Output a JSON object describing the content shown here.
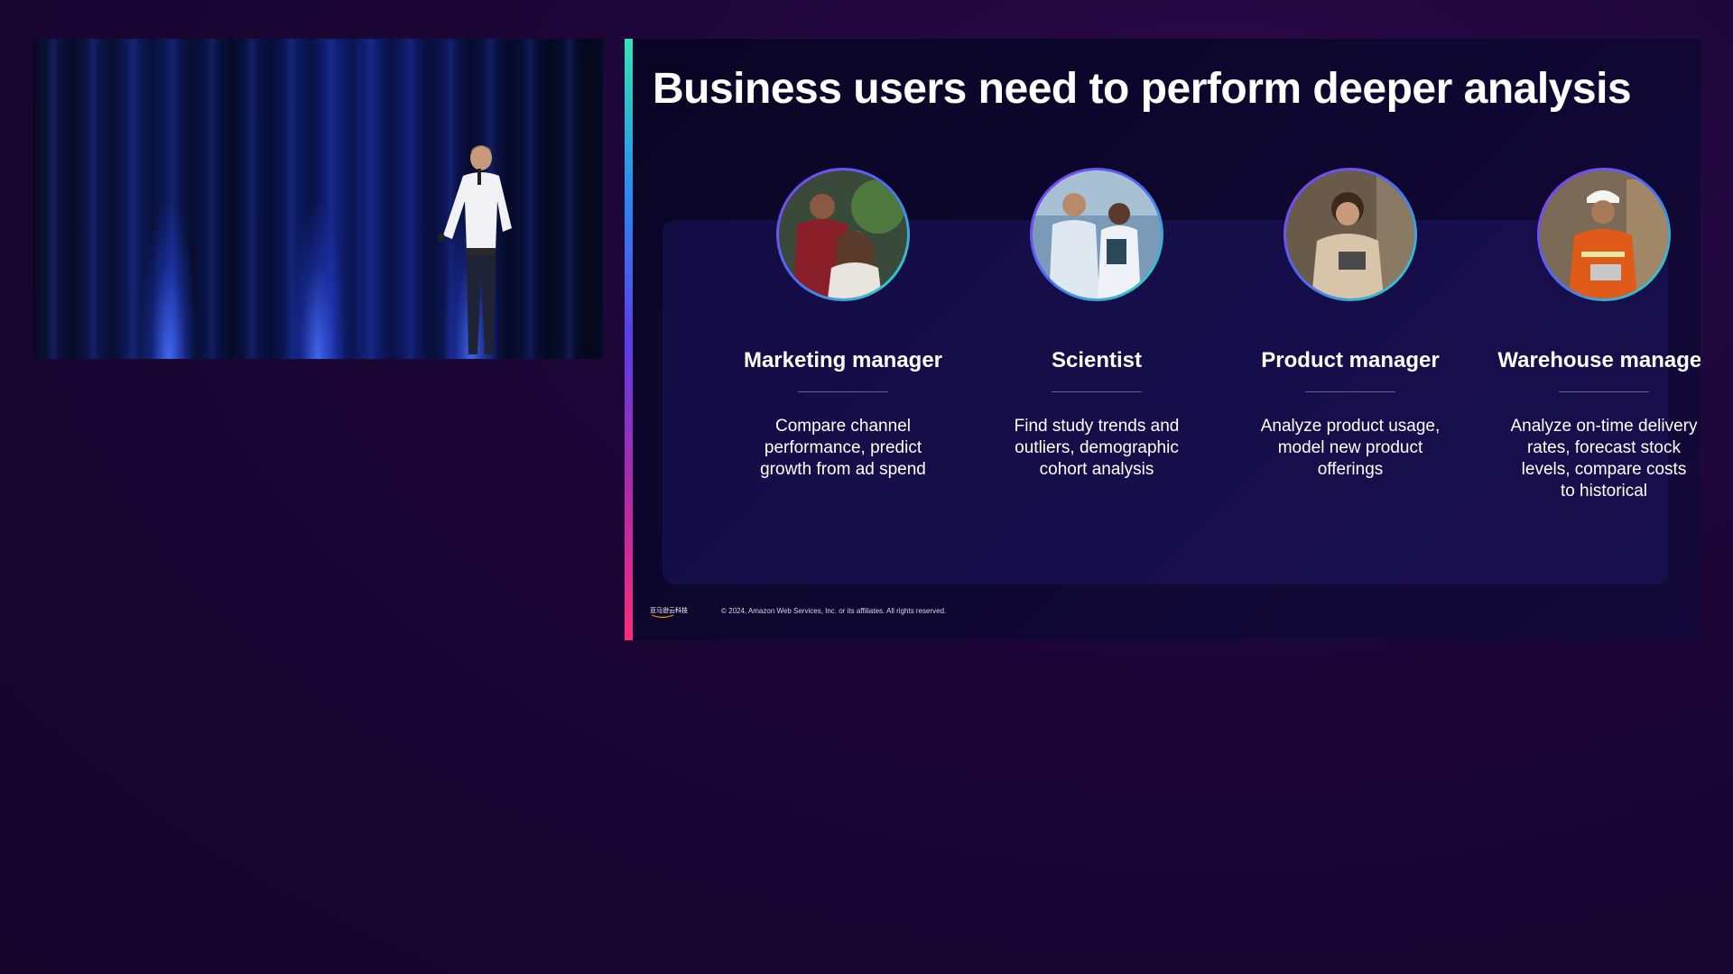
{
  "slide": {
    "title": "Business users need to perform deeper analysis",
    "footer": "© 2024, Amazon Web Services, Inc. or its affiliates. All rights reserved.",
    "logo_text": "亚马逊云科技",
    "personas": [
      {
        "title": "Marketing manager",
        "description": "Compare channel\nperformance, predict\ngrowth from ad spend",
        "photo_icon": "two-coworkers-at-laptop-photo"
      },
      {
        "title": "Scientist",
        "description": "Find study trends and\noutliers, demographic\ncohort analysis",
        "photo_icon": "scientists-with-tablet-photo"
      },
      {
        "title": "Product manager",
        "description": "Analyze product usage,\nmodel new product\nofferings",
        "photo_icon": "woman-with-tablet-photo"
      },
      {
        "title": "Warehouse manager",
        "description": "Analyze on-time delivery\nrates, forecast stock\nlevels, compare costs\nto historical",
        "photo_icon": "warehouse-worker-photo"
      }
    ]
  },
  "colors": {
    "background": "#1c0636",
    "slide_background": "#0e0730",
    "accent_start": "#2fe6b4",
    "accent_end": "#ff2a7a",
    "card_panel": "#1e145f"
  }
}
